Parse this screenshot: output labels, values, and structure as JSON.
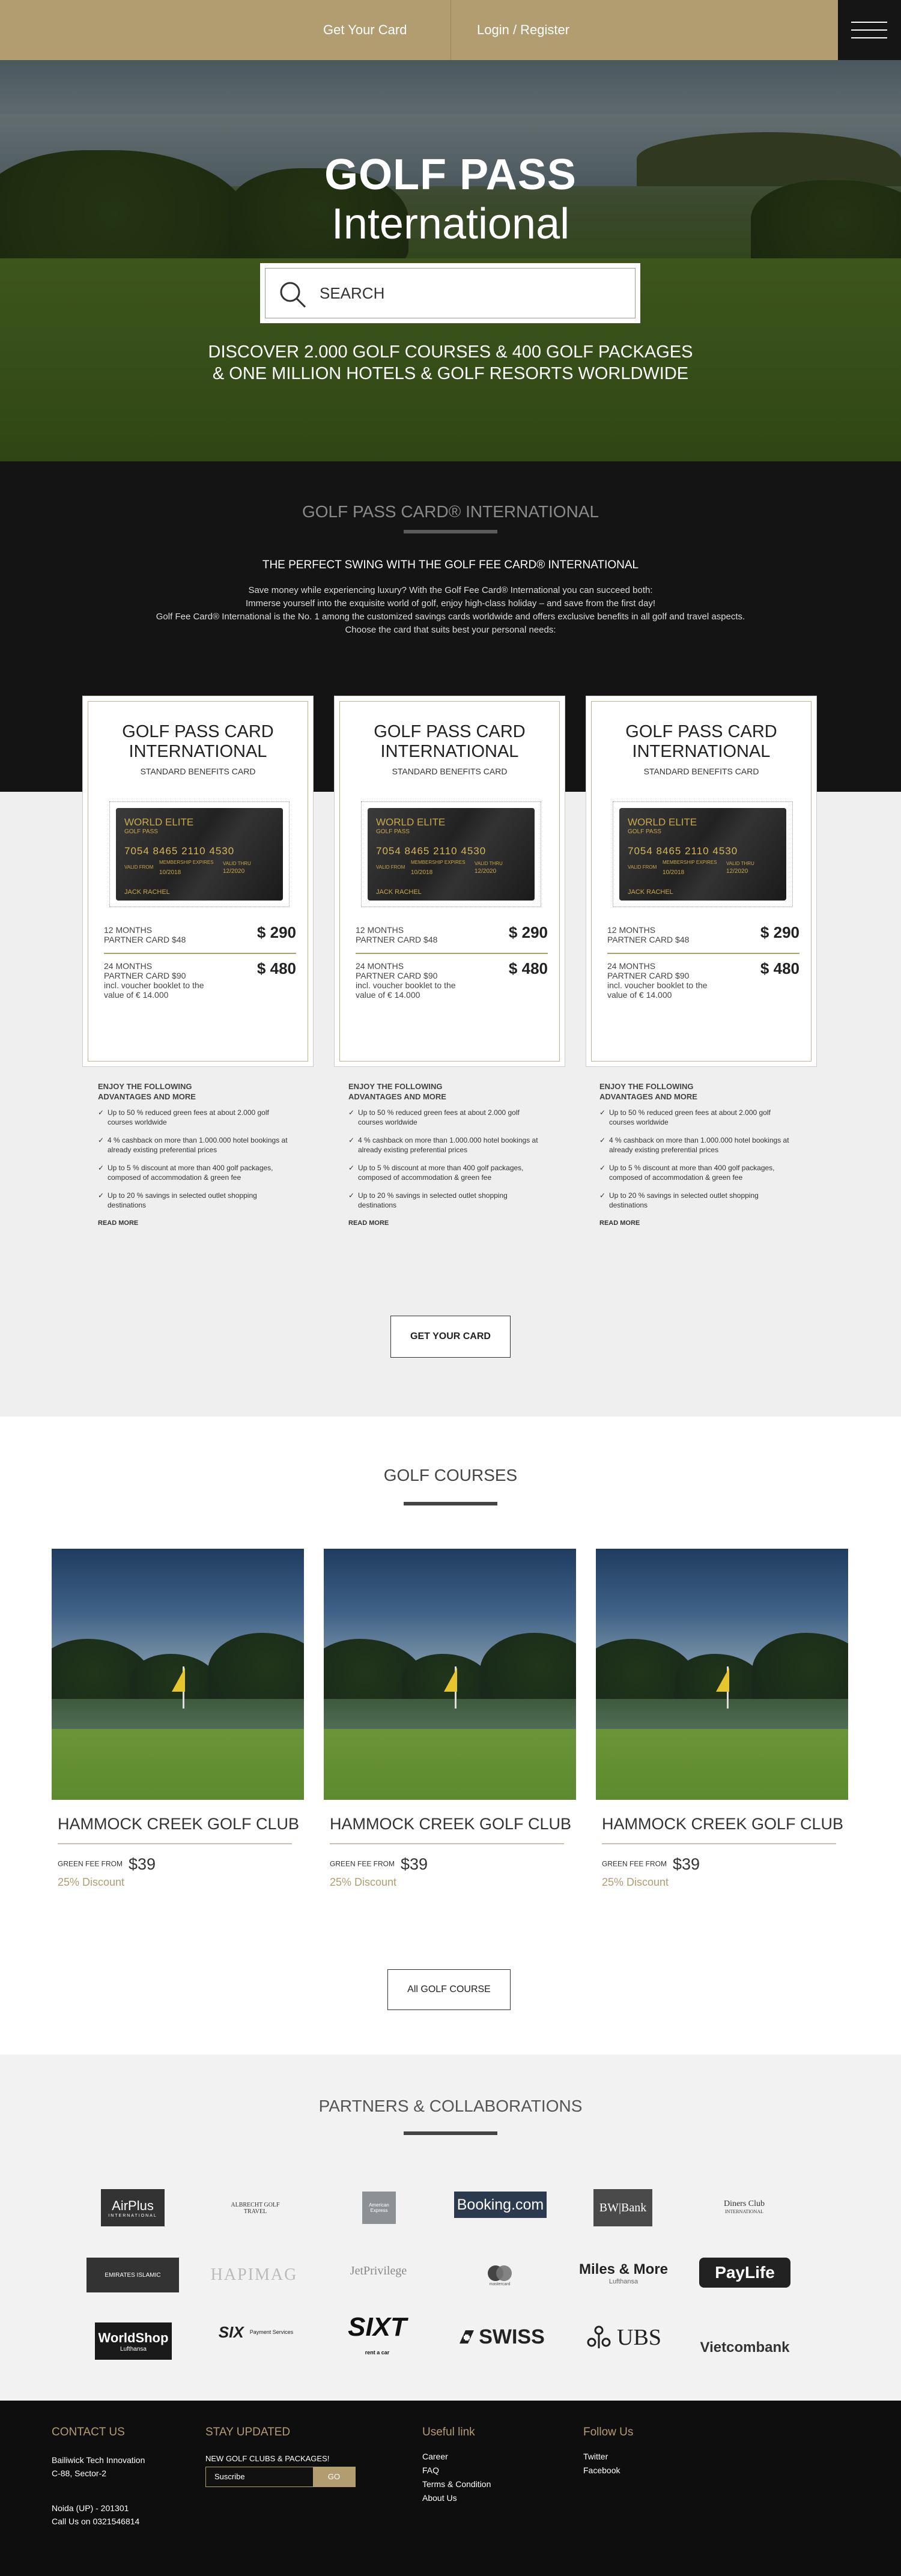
{
  "colors": {
    "accent": "#b29d71",
    "dark": "#141414",
    "light_bg": "#efefef"
  },
  "topbar": {
    "get_card": "Get Your Card",
    "login": "Login / Register"
  },
  "hero": {
    "title": "GOLF PASS",
    "subtitle": "International",
    "search_placeholder": "SEARCH",
    "tagline1": "DISCOVER 2.000 GOLF COURSES & 400 GOLF PACKAGES",
    "tagline2": "& ONE MILLION HOTELS & GOLF RESORTS WORLDWIDE"
  },
  "card_section": {
    "title": "GOLF PASS CARD® INTERNATIONAL",
    "heading": "THE PERFECT SWING WITH THE GOLF FEE CARD® INTERNATIONAL",
    "p1": "Save money while experiencing luxury? With the Golf Fee Card® International you can succeed both:",
    "p2": "Immerse yourself into the exquisite world of golf, enjoy high-class holiday – and save from the first day!",
    "p3": "Golf Fee Card® International is the No. 1 among the customized savings cards worldwide and offers exclusive benefits in all golf and travel aspects.",
    "p4": "Choose the card that suits best your personal needs:",
    "cta": "GET YOUR CARD",
    "cards": [
      {
        "title1": "GOLF PASS CARD",
        "title2": "INTERNATIONAL",
        "sub": "STANDARD BENEFITS CARD",
        "card_brand": "WORLD ELITE",
        "card_sub": "GOLF PASS",
        "card_number": "7054  8465  2110  4530",
        "valid_label": "VALID FROM",
        "valid_date": "10/2018",
        "member_label": "MEMBERSHIP EXPIRES",
        "expires_label": "VALID THRU",
        "expires_date": "12/2020",
        "holder": "JACK RACHEL",
        "p12_label": "12 MONTHS",
        "p12_sub": "PARTNER CARD  $48",
        "p12_price": "$ 290",
        "p24_label": "24 MONTHS",
        "p24_sub": "PARTNER CARD  $90",
        "p24_note": "incl. voucher booklet to the value of € 14.000",
        "p24_price": "$ 480"
      },
      {
        "title1": "GOLF PASS CARD",
        "title2": "INTERNATIONAL",
        "sub": "STANDARD BENEFITS CARD",
        "card_brand": "WORLD ELITE",
        "card_sub": "GOLF PASS",
        "card_number": "7054  8465  2110  4530",
        "valid_label": "VALID FROM",
        "valid_date": "10/2018",
        "member_label": "MEMBERSHIP EXPIRES",
        "expires_label": "VALID THRU",
        "expires_date": "12/2020",
        "holder": "JACK RACHEL",
        "p12_label": "12 MONTHS",
        "p12_sub": "PARTNER CARD  $48",
        "p12_price": "$ 290",
        "p24_label": "24 MONTHS",
        "p24_sub": "PARTNER CARD  $90",
        "p24_note": "incl. voucher booklet to the value of € 14.000",
        "p24_price": "$ 480"
      },
      {
        "title1": "GOLF PASS CARD",
        "title2": "INTERNATIONAL",
        "sub": "STANDARD BENEFITS CARD",
        "card_brand": "WORLD ELITE",
        "card_sub": "GOLF PASS",
        "card_number": "7054  8465  2110  4530",
        "valid_label": "VALID FROM",
        "valid_date": "10/2018",
        "member_label": "MEMBERSHIP EXPIRES",
        "expires_label": "VALID THRU",
        "expires_date": "12/2020",
        "holder": "JACK RACHEL",
        "p12_label": "12 MONTHS",
        "p12_sub": "PARTNER CARD  $48",
        "p12_price": "$ 290",
        "p24_label": "24 MONTHS",
        "p24_sub": "PARTNER CARD  $90",
        "p24_note": "incl. voucher booklet to the value of € 14.000",
        "p24_price": "$ 480"
      }
    ],
    "features": {
      "heading1": "ENJOY THE FOLLOWING",
      "heading2": "ADVANTAGES AND MORE",
      "items": [
        "Up to 50 % reduced green fees at about 2.000 golf courses worldwide",
        "4 % cashback on more than 1.000.000 hotel bookings at already existing preferential prices",
        "Up to 5 % discount at more than 400 golf packages, composed of accommodation & green fee",
        "Up to 20 % savings in selected outlet shopping destinations"
      ],
      "read_more": "READ MORE"
    }
  },
  "courses": {
    "title": "GOLF COURSES",
    "items": [
      {
        "name": "HAMMOCK CREEK GOLF CLUB",
        "fee_label": "GREEN FEE FROM",
        "fee": "$39",
        "discount": "25% Discount"
      },
      {
        "name": "HAMMOCK CREEK GOLF CLUB",
        "fee_label": "GREEN FEE FROM",
        "fee": "$39",
        "discount": "25% Discount"
      },
      {
        "name": "HAMMOCK CREEK GOLF CLUB",
        "fee_label": "GREEN FEE FROM",
        "fee": "$39",
        "discount": "25% Discount"
      }
    ],
    "all_button": "All GOLF COURSE"
  },
  "partners": {
    "title": "PARTNERS & COLLABORATIONS",
    "logos": [
      "AirPlus",
      "ALBRECHT GOLF TRAVEL",
      "American Express",
      "Booking.com",
      "BW|Bank",
      "Diners Club INTERNATIONAL",
      "EMIRATES ISLAMIC",
      "HAPIMAG",
      "JetPrivilege",
      "mastercard",
      "Miles & More",
      "PayLife",
      "WorldShop",
      "SIX Payment Services",
      "SIXT",
      "SWISS",
      "UBS",
      "Vietcombank"
    ],
    "logo_subs": {
      "airplus": "INTERNATIONAL",
      "lufthansa": "Lufthansa",
      "sixt": "rent a car",
      "albrecht": "ALBRECHT GOLF",
      "albrecht2": "TRAVEL",
      "diners": "Diners Club",
      "diners2": "INTERNATIONAL",
      "six": "SIX",
      "six2": "Payment Services",
      "emirates": "EMIRATES ISLAMIC"
    }
  },
  "footer": {
    "contact_title": "CONTACT US",
    "contact_l1": "Bailiwick Tech Innovation",
    "contact_l2": "C-88, Sector-2",
    "contact_l3": "Noida (UP) - 201301",
    "contact_l4": "Call Us on 0321546814",
    "update_title": "STAY UPDATED",
    "update_text": "NEW GOLF CLUBS & PACKAGES!",
    "subscribe_placeholder": "Suscribe",
    "go": "GO",
    "useful_title": "Useful link",
    "useful": [
      "Career",
      "FAQ",
      "Terms & Condition",
      "About Us"
    ],
    "follow_title": "Follow Us",
    "follow": [
      "Twitter",
      "Facebook"
    ]
  }
}
